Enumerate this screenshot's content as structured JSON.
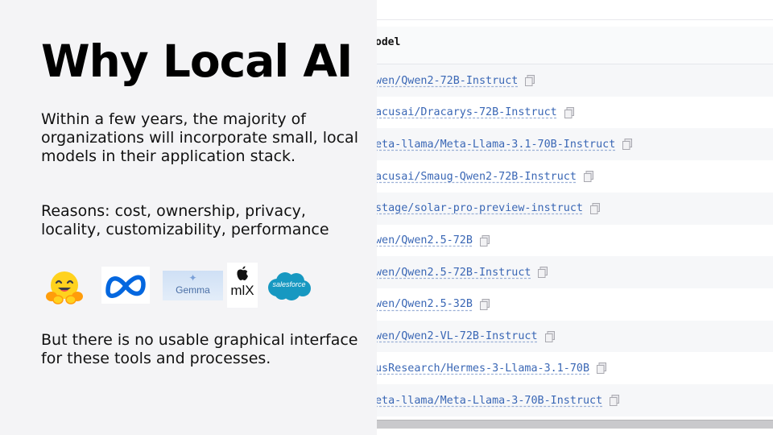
{
  "slide": {
    "title": "Why Local AI",
    "paragraph1": "Within a few years, the majority of organizations will incorporate small, local models in their application stack.",
    "paragraph2": "Reasons: cost, ownership, privacy, locality, customizability, performance",
    "paragraph3": "But there is no usable graphical interface for these tools and processes.",
    "logos": [
      {
        "name": "huggingface",
        "icon": "hugging-face-emoji"
      },
      {
        "name": "meta",
        "icon": "meta-infinity-logo"
      },
      {
        "name": "gemma",
        "text": "Gemma"
      },
      {
        "name": "mlx",
        "text": "mlX"
      },
      {
        "name": "salesforce",
        "text": "salesforce"
      }
    ]
  },
  "table": {
    "header": "odel",
    "rows": [
      "wen/Qwen2-72B-Instruct",
      "acusai/Dracarys-72B-Instruct",
      "eta-llama/Meta-Llama-3.1-70B-Instruct",
      "acusai/Smaug-Qwen2-72B-Instruct",
      "stage/solar-pro-preview-instruct",
      "wen/Qwen2.5-72B",
      "wen/Qwen2.5-72B-Instruct",
      "wen/Qwen2.5-32B",
      "wen/Qwen2-VL-72B-Instruct",
      "usResearch/Hermes-3-Llama-3.1-70B",
      "eta-llama/Meta-Llama-3-70B-Instruct"
    ],
    "copy_icon": "copy-icon"
  },
  "colors": {
    "link": "#3a67b5",
    "title": "#000000",
    "slide_bg": "#f4f4f6",
    "salesforce": "#1798c1",
    "meta": "#0467df"
  }
}
